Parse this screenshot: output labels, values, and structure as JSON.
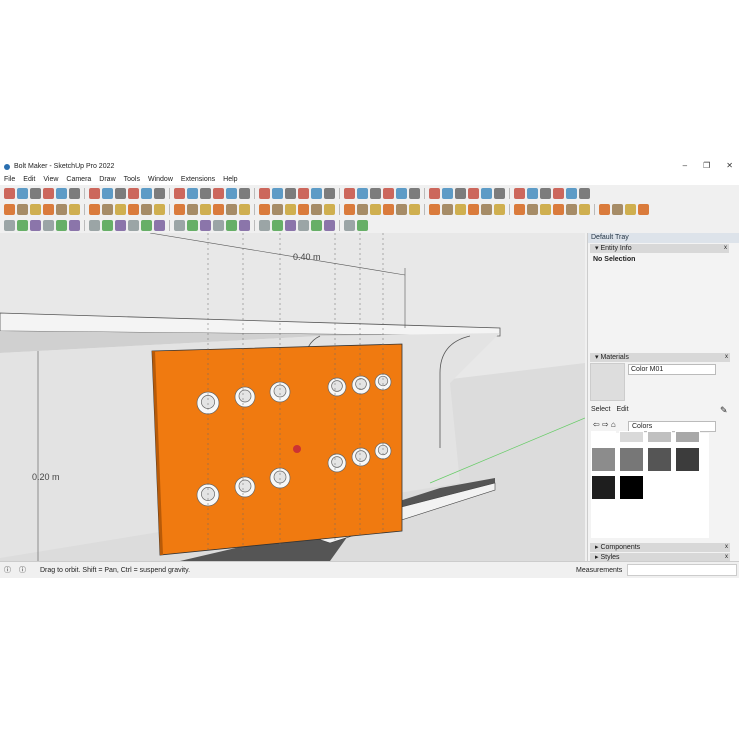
{
  "window": {
    "title": "Bolt Maker - SketchUp Pro 2022",
    "controls": [
      "–",
      "❐",
      "✕"
    ]
  },
  "menu": [
    "File",
    "Edit",
    "View",
    "Camera",
    "Draw",
    "Tools",
    "Window",
    "Extensions",
    "Help"
  ],
  "toolbars": {
    "row1_count": 42,
    "row2_count": 46,
    "row3_count": 26
  },
  "viewport": {
    "dim_top": "0.40 m",
    "dim_left": "0.20 m",
    "plate_color": "#f07a10"
  },
  "tray": {
    "title": "Default Tray",
    "entity_info": {
      "title": "Entity Info",
      "value": "No Selection"
    },
    "materials": {
      "title": "Materials",
      "name_value": "Color M01",
      "tabs": [
        "Select",
        "Edit"
      ],
      "library": "Colors",
      "swatches": [
        "#ffffff",
        "#d9d9d9",
        "#c0c0c0",
        "#a8a8a8",
        "#8c8c8c",
        "#777777",
        "#555555",
        "#3c3c3c",
        "#1e1e1e",
        "#000000"
      ]
    },
    "collapsed": [
      "Components",
      "Styles"
    ]
  },
  "status": {
    "hint": "Drag to orbit. Shift = Pan, Ctrl = suspend gravity.",
    "measurements_label": "Measurements",
    "measurements_value": ""
  }
}
